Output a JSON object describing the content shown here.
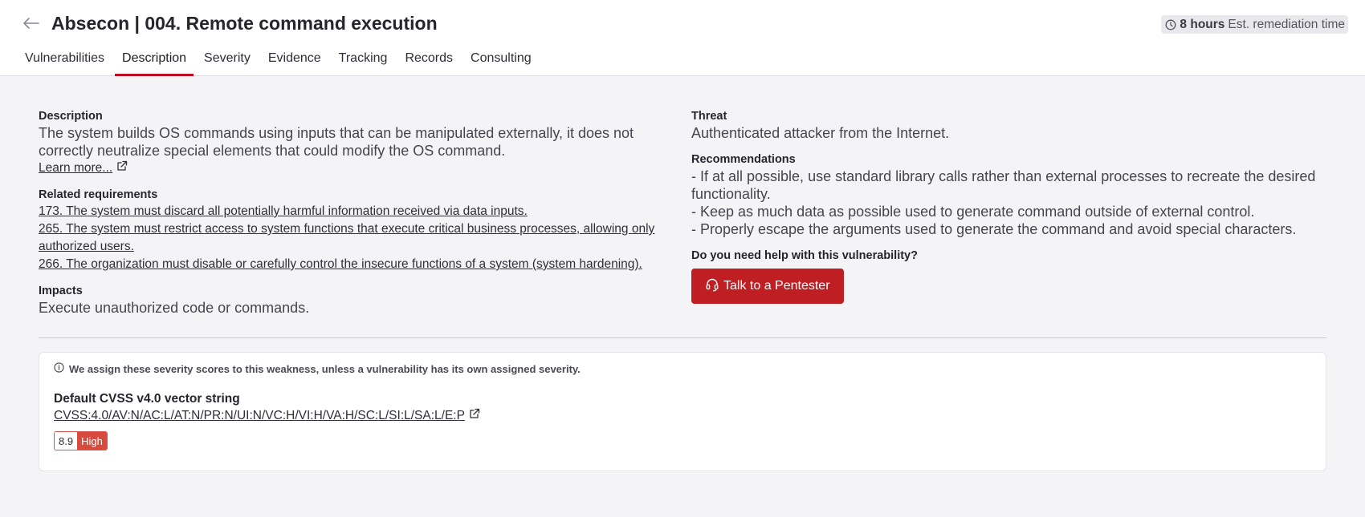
{
  "header": {
    "title": "Absecon | 004. Remote command execution",
    "remediation": {
      "value": "8 hours",
      "label": "Est. remediation time"
    }
  },
  "tabs": [
    {
      "label": "Vulnerabilities",
      "active": false
    },
    {
      "label": "Description",
      "active": true
    },
    {
      "label": "Severity",
      "active": false
    },
    {
      "label": "Evidence",
      "active": false
    },
    {
      "label": "Tracking",
      "active": false
    },
    {
      "label": "Records",
      "active": false
    },
    {
      "label": "Consulting",
      "active": false
    }
  ],
  "description": {
    "heading": "Description",
    "text": "The system builds OS commands using inputs that can be manipulated externally, it does not correctly neutralize special elements that could modify the OS command.",
    "learn_more": "Learn more..."
  },
  "requirements": {
    "heading": "Related requirements",
    "items": [
      "173. The system must discard all potentially harmful information received via data inputs.",
      "265. The system must restrict access to system functions that execute critical business processes, allowing only authorized users.",
      "266. The organization must disable or carefully control the insecure functions of a system (system hardening)."
    ]
  },
  "impacts": {
    "heading": "Impacts",
    "text": "Execute unauthorized code or commands."
  },
  "threat": {
    "heading": "Threat",
    "text": "Authenticated attacker from the Internet."
  },
  "recommendations": {
    "heading": "Recommendations",
    "items": [
      "- If at all possible, use standard library calls rather than external processes to recreate the desired functionality.",
      "- Keep as much data as possible used to generate command outside of external control.",
      "- Properly escape the arguments used to generate the command and avoid special characters."
    ]
  },
  "help": {
    "heading": "Do you need help with this vulnerability?",
    "button_label": "Talk to a Pentester"
  },
  "cvss": {
    "note": "We assign these severity scores to this weakness, unless a vulnerability has its own assigned severity.",
    "title": "Default CVSS v4.0 vector string",
    "vector": "CVSS:4.0/AV:N/AC:L/AT:N/PR:N/UI:N/VC:H/VI:H/VA:H/SC:L/SI:L/SA:L/E:P",
    "score": "8.9",
    "severity": "High"
  },
  "icons": {
    "back": "arrow-left-icon",
    "clock": "clock-icon",
    "external_link": "external-link-icon",
    "headset": "headset-icon",
    "info": "info-circle-icon"
  },
  "colors": {
    "accent": "#bf1e23",
    "tab_indicator": "#bf0b1f",
    "severity_high": "#d94a3e"
  }
}
